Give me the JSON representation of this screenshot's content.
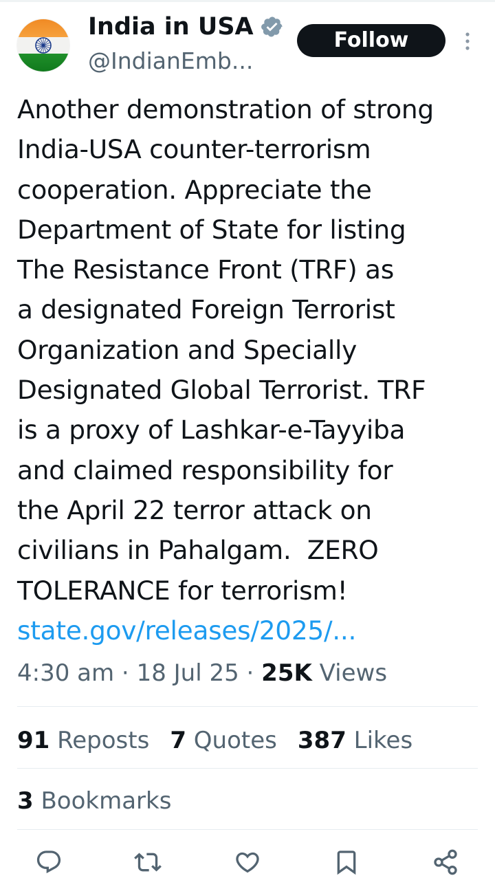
{
  "author": {
    "display_name": "India in USA",
    "handle": "@IndianEmb...",
    "verified": true,
    "avatar": "indian-flag"
  },
  "follow_label": "Follow",
  "tweet": {
    "text": "Another demonstration of strong\nIndia-USA counter-terrorism\ncooperation. Appreciate the\nDepartment of State for listing\nThe Resistance Front (TRF) as\na designated Foreign Terrorist\nOrganization and Specially\nDesignated Global Terrorist. TRF\nis a proxy of Lashkar-e-Tayyiba\nand claimed responsibility for\nthe April 22 terror attack on\ncivilians in Pahalgam.  ZERO\nTOLERANCE for terrorism!",
    "link": "state.gov/releases/2025/..."
  },
  "meta": {
    "time": "4:30 am",
    "sep": " · ",
    "date": "18 Jul 25",
    "views_count": "25K",
    "views_label": "Views"
  },
  "stats": {
    "reposts_count": "91",
    "reposts_label": "Reposts",
    "quotes_count": "7",
    "quotes_label": "Quotes",
    "likes_count": "387",
    "likes_label": "Likes",
    "bookmarks_count": "3",
    "bookmarks_label": "Bookmarks"
  },
  "actions": [
    "reply-icon",
    "repost-icon",
    "like-icon",
    "bookmark-icon",
    "share-icon"
  ],
  "colors": {
    "text": "#0f1419",
    "secondary": "#536471",
    "link": "#1d9bf0",
    "verified_badge": "#829aab",
    "follow_bg": "#0f1419"
  }
}
